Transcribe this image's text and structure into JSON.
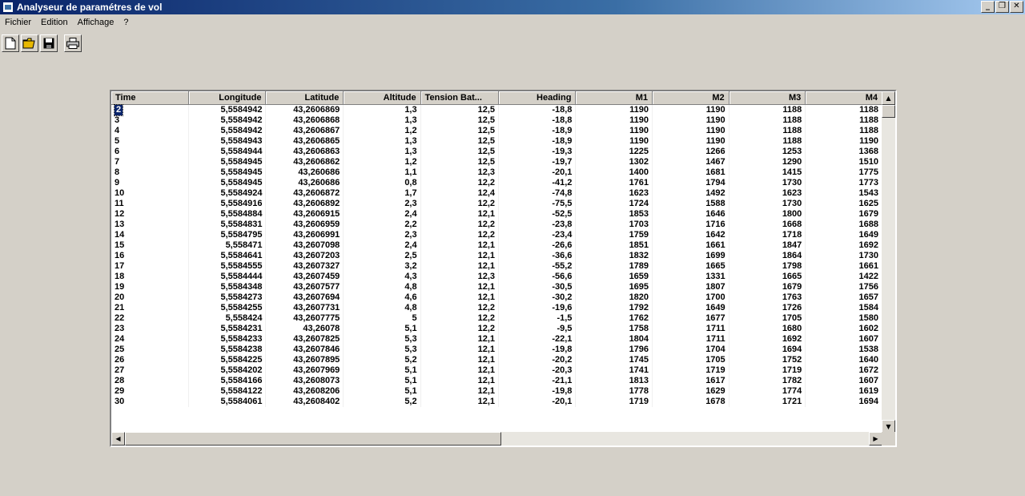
{
  "window": {
    "title": "Analyseur de paramétres de vol",
    "minimize_label": "_",
    "restore_label": "❐",
    "close_label": "✕"
  },
  "menu": [
    "Fichier",
    "Edition",
    "Affichage",
    "?"
  ],
  "toolbar": {
    "buttons": [
      {
        "name": "new-file-icon"
      },
      {
        "name": "open-folder-icon"
      },
      {
        "name": "save-icon"
      },
      {
        "name": "print-icon"
      }
    ]
  },
  "table": {
    "columns": [
      "Time",
      "Longitude",
      "Latitude",
      "Altitude",
      "Tension Bat...",
      "Heading",
      "M1",
      "M2",
      "M3",
      "M4"
    ],
    "selected_cell": "2",
    "rows": [
      [
        "2",
        "5,5584942",
        "43,2606869",
        "1,3",
        "12,5",
        "-18,8",
        "1190",
        "1190",
        "1188",
        "1188"
      ],
      [
        "3",
        "5,5584942",
        "43,2606868",
        "1,3",
        "12,5",
        "-18,8",
        "1190",
        "1190",
        "1188",
        "1188"
      ],
      [
        "4",
        "5,5584942",
        "43,2606867",
        "1,2",
        "12,5",
        "-18,9",
        "1190",
        "1190",
        "1188",
        "1188"
      ],
      [
        "5",
        "5,5584943",
        "43,2606865",
        "1,3",
        "12,5",
        "-18,9",
        "1190",
        "1190",
        "1188",
        "1190"
      ],
      [
        "6",
        "5,5584944",
        "43,2606863",
        "1,3",
        "12,5",
        "-19,3",
        "1225",
        "1266",
        "1253",
        "1368"
      ],
      [
        "7",
        "5,5584945",
        "43,2606862",
        "1,2",
        "12,5",
        "-19,7",
        "1302",
        "1467",
        "1290",
        "1510"
      ],
      [
        "8",
        "5,5584945",
        "43,260686",
        "1,1",
        "12,3",
        "-20,1",
        "1400",
        "1681",
        "1415",
        "1775"
      ],
      [
        "9",
        "5,5584945",
        "43,260686",
        "0,8",
        "12,2",
        "-41,2",
        "1761",
        "1794",
        "1730",
        "1773"
      ],
      [
        "10",
        "5,5584924",
        "43,2606872",
        "1,7",
        "12,4",
        "-74,8",
        "1623",
        "1492",
        "1623",
        "1543"
      ],
      [
        "11",
        "5,5584916",
        "43,2606892",
        "2,3",
        "12,2",
        "-75,5",
        "1724",
        "1588",
        "1730",
        "1625"
      ],
      [
        "12",
        "5,5584884",
        "43,2606915",
        "2,4",
        "12,1",
        "-52,5",
        "1853",
        "1646",
        "1800",
        "1679"
      ],
      [
        "13",
        "5,5584831",
        "43,2606959",
        "2,2",
        "12,2",
        "-23,8",
        "1703",
        "1716",
        "1668",
        "1688"
      ],
      [
        "14",
        "5,5584795",
        "43,2606991",
        "2,3",
        "12,2",
        "-23,4",
        "1759",
        "1642",
        "1718",
        "1649"
      ],
      [
        "15",
        "5,558471",
        "43,2607098",
        "2,4",
        "12,1",
        "-26,6",
        "1851",
        "1661",
        "1847",
        "1692"
      ],
      [
        "16",
        "5,5584641",
        "43,2607203",
        "2,5",
        "12,1",
        "-36,6",
        "1832",
        "1699",
        "1864",
        "1730"
      ],
      [
        "17",
        "5,5584555",
        "43,2607327",
        "3,2",
        "12,1",
        "-55,2",
        "1789",
        "1665",
        "1798",
        "1661"
      ],
      [
        "18",
        "5,5584444",
        "43,2607459",
        "4,3",
        "12,3",
        "-56,6",
        "1659",
        "1331",
        "1665",
        "1422"
      ],
      [
        "19",
        "5,5584348",
        "43,2607577",
        "4,8",
        "12,1",
        "-30,5",
        "1695",
        "1807",
        "1679",
        "1756"
      ],
      [
        "20",
        "5,5584273",
        "43,2607694",
        "4,6",
        "12,1",
        "-30,2",
        "1820",
        "1700",
        "1763",
        "1657"
      ],
      [
        "21",
        "5,5584255",
        "43,2607731",
        "4,8",
        "12,2",
        "-19,6",
        "1792",
        "1649",
        "1726",
        "1584"
      ],
      [
        "22",
        "5,558424",
        "43,2607775",
        "5",
        "12,2",
        "-1,5",
        "1762",
        "1677",
        "1705",
        "1580"
      ],
      [
        "23",
        "5,5584231",
        "43,26078",
        "5,1",
        "12,2",
        "-9,5",
        "1758",
        "1711",
        "1680",
        "1602"
      ],
      [
        "24",
        "5,5584233",
        "43,2607825",
        "5,3",
        "12,1",
        "-22,1",
        "1804",
        "1711",
        "1692",
        "1607"
      ],
      [
        "25",
        "5,5584238",
        "43,2607846",
        "5,3",
        "12,1",
        "-19,8",
        "1796",
        "1704",
        "1694",
        "1538"
      ],
      [
        "26",
        "5,5584225",
        "43,2607895",
        "5,2",
        "12,1",
        "-20,2",
        "1745",
        "1705",
        "1752",
        "1640"
      ],
      [
        "27",
        "5,5584202",
        "43,2607969",
        "5,1",
        "12,1",
        "-20,3",
        "1741",
        "1719",
        "1719",
        "1672"
      ],
      [
        "28",
        "5,5584166",
        "43,2608073",
        "5,1",
        "12,1",
        "-21,1",
        "1813",
        "1617",
        "1782",
        "1607"
      ],
      [
        "29",
        "5,5584122",
        "43,2608206",
        "5,1",
        "12,1",
        "-19,8",
        "1778",
        "1629",
        "1774",
        "1619"
      ],
      [
        "30",
        "5,5584061",
        "43,2608402",
        "5,2",
        "12,1",
        "-20,1",
        "1719",
        "1678",
        "1721",
        "1694"
      ]
    ]
  },
  "scrollbar": {
    "up_label": "▲",
    "down_label": "▼",
    "left_label": "◀",
    "right_label": "▶"
  }
}
